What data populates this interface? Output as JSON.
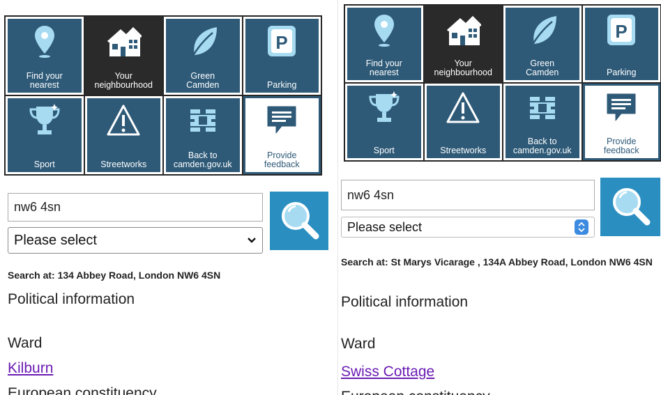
{
  "left": {
    "tiles": [
      {
        "label": "Find your\nnearest",
        "icon": "location-pin-icon"
      },
      {
        "label": "Your\nneighbourhood",
        "icon": "houses-icon"
      },
      {
        "label": "Green\nCamden",
        "icon": "leaf-icon"
      },
      {
        "label": "Parking",
        "icon": "parking-icon"
      },
      {
        "label": "Sport",
        "icon": "trophy-icon"
      },
      {
        "label": "Streetworks",
        "icon": "warning-icon"
      },
      {
        "label": "Back to\ncamden.gov.uk",
        "icon": "camden-logo-icon"
      },
      {
        "label": "Provide\nfeedback",
        "icon": "speech-bubble-icon"
      }
    ],
    "search_value": "nw6 4sn",
    "select_value": "Please select",
    "search_at": "Search at: 134 Abbey Road, London NW6 4SN",
    "political_info": "Political information",
    "ward_heading": "Ward",
    "ward_link": "Kilburn",
    "euro_heading": "European constituency"
  },
  "right": {
    "tiles": [
      {
        "label": "Find your\nnearest",
        "icon": "location-pin-icon"
      },
      {
        "label": "Your\nneighbourhood",
        "icon": "houses-icon"
      },
      {
        "label": "Green\nCamden",
        "icon": "leaf-icon"
      },
      {
        "label": "Parking",
        "icon": "parking-icon"
      },
      {
        "label": "Sport",
        "icon": "trophy-icon"
      },
      {
        "label": "Streetworks",
        "icon": "warning-icon"
      },
      {
        "label": "Back to\ncamden.gov.uk",
        "icon": "camden-logo-icon"
      },
      {
        "label": "Provide\nfeedback",
        "icon": "speech-bubble-icon"
      }
    ],
    "search_value": "nw6 4sn",
    "select_value": "Please select",
    "search_at": "Search at: St Marys Vicarage , 134A Abbey Road, London NW6 4SN",
    "political_info": "Political information",
    "ward_heading": "Ward",
    "ward_link": "Swiss Cottage",
    "euro_heading": "European constituency"
  },
  "colors": {
    "tile_blue": "#2e5a78",
    "tile_dark": "#2a2a2a",
    "search_button": "#2a8fc0",
    "link": "#6a1bb3"
  }
}
